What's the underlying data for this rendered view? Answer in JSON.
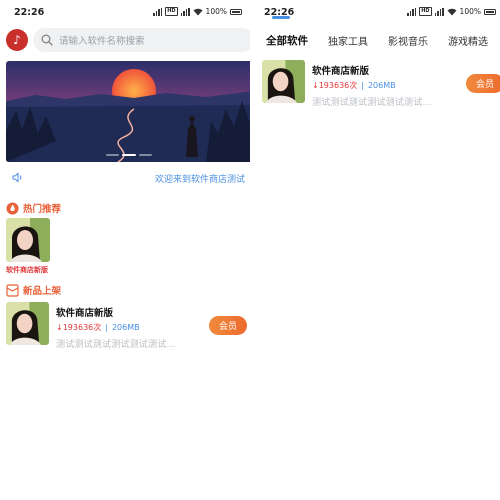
{
  "status_bar": {
    "time": "22:26",
    "battery": "100%"
  },
  "left": {
    "search": {
      "placeholder": "请输入软件名称搜索"
    },
    "notice": "欢迎来到软件商店测试",
    "hot_section": {
      "title": "热门推荐",
      "items": [
        {
          "name": "软件商店新版"
        }
      ]
    },
    "new_section": {
      "title": "新品上架",
      "items": [
        {
          "name": "软件商店新版",
          "downloads": "193636次",
          "size": "206MB",
          "desc": "测试测试测试测试测试测试…",
          "button": "会员"
        }
      ]
    }
  },
  "right": {
    "tabs": [
      "全部软件",
      "独家工具",
      "影视音乐",
      "游戏精选"
    ],
    "active_tab": 0,
    "items": [
      {
        "name": "软件商店新版",
        "downloads": "193636次",
        "size": "206MB",
        "desc": "测试测试测试测试测试测试…",
        "button": "会员"
      }
    ]
  },
  "colors": {
    "accent_blue": "#4a90e2",
    "accent_orange": "#ee6a2e",
    "section_title": "#e8613a",
    "download_red": "#e0373a"
  }
}
